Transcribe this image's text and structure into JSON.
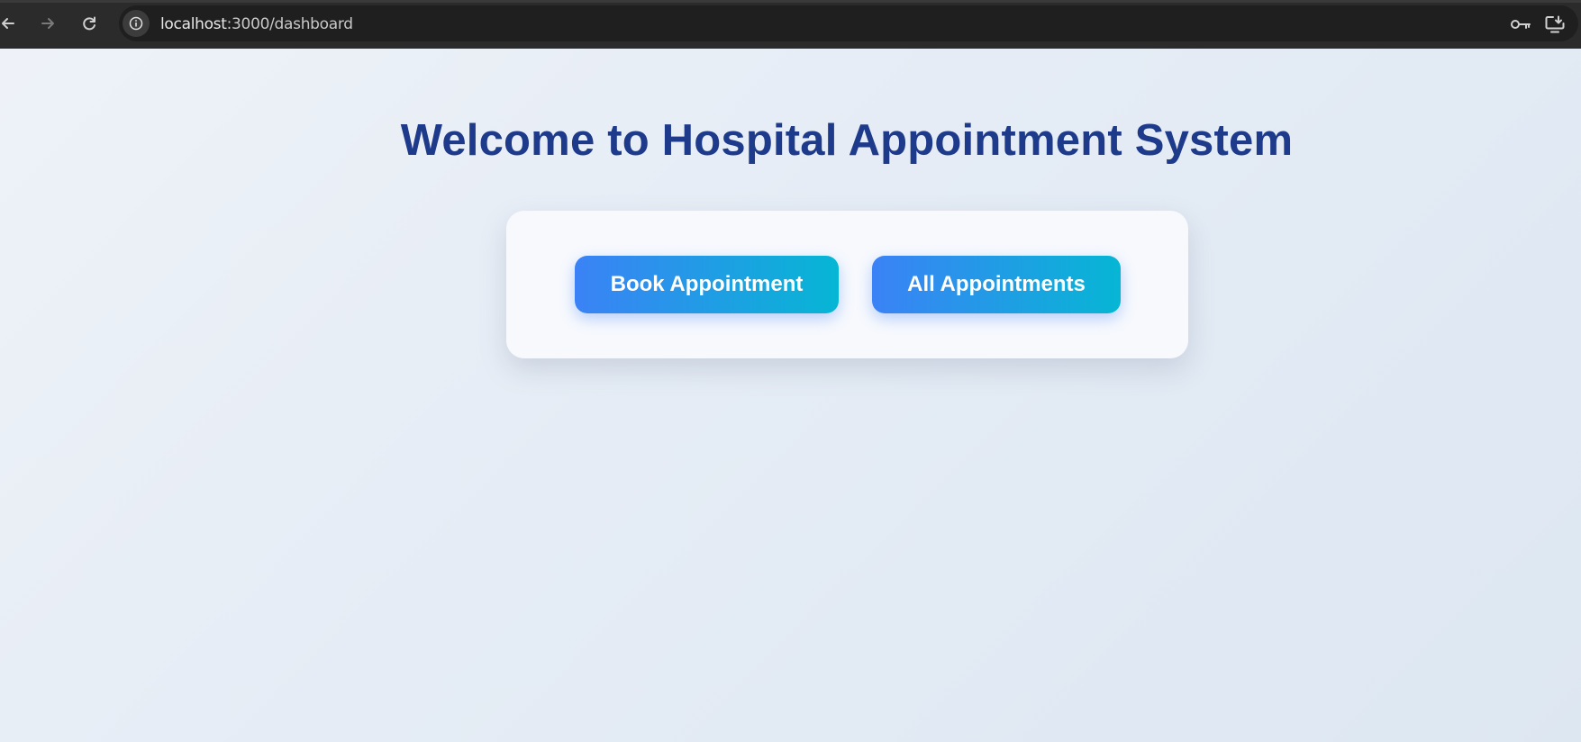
{
  "browser": {
    "url_host": "localhost",
    "url_path": ":3000/dashboard"
  },
  "page": {
    "title": "Welcome to Hospital Appointment System",
    "buttons": {
      "book": "Book Appointment",
      "all": "All Appointments"
    }
  },
  "colors": {
    "title": "#1e3a8a",
    "button_gradient_start": "#3b82f6",
    "button_gradient_end": "#06b6d4",
    "browser_chrome": "#2b2b2b"
  },
  "icons": {
    "back": "arrow-left-icon",
    "forward": "arrow-right-icon",
    "reload": "reload-icon",
    "site_info": "info-icon",
    "password": "key-icon",
    "install": "install-app-icon"
  }
}
